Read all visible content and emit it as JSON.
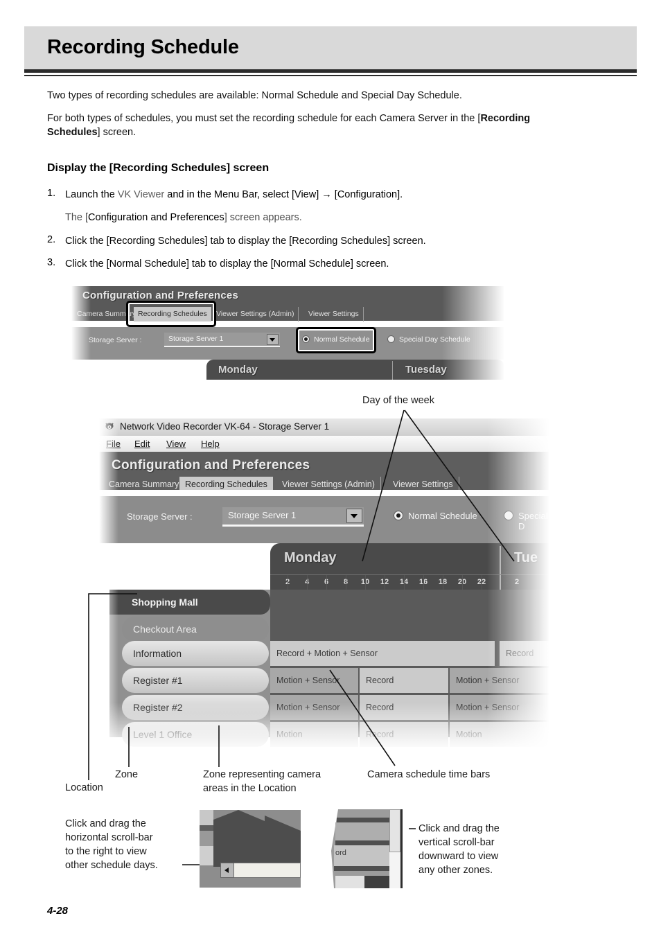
{
  "page": {
    "title": "Recording Schedule",
    "footer": "4-28"
  },
  "intro": {
    "para1": "Two types of recording schedules are available: Normal Schedule and Special Day Schedule.",
    "para2_a": "For both types of schedules, you must set the recording schedule for each Camera Server in the [",
    "para2_b": "Recording",
    "para2_c": "Schedules",
    "para2_d": "] screen."
  },
  "section": {
    "heading": "Display the [Recording Schedules] screen",
    "steps": [
      {
        "num": "1.",
        "text_a": "Launch the ",
        "text_b": "VK Viewer",
        "text_c": " and in the Menu Bar, select [View] → [Configuration]."
      },
      {
        "num": "",
        "text_a": "The [",
        "text_b": "Configuration and Preferences",
        "text_c": "] screen appears."
      },
      {
        "num": "2.",
        "text_a": "Click the [Recording Schedules] tab to display the [Recording Schedules] screen.",
        "text_b": "",
        "text_c": ""
      },
      {
        "num": "3.",
        "text_a": "Click the [Normal Schedule] tab to display the [Normal Schedule] screen.",
        "text_b": "",
        "text_c": ""
      }
    ]
  },
  "figure1": {
    "caption": "Configuration and Preferences",
    "tabs": [
      {
        "label": "Camera Summary",
        "active": false
      },
      {
        "label": "Recording Schedules",
        "active": true
      },
      {
        "label": "Viewer Settings (Admin)",
        "active": false
      },
      {
        "label": "Viewer Settings",
        "active": false
      }
    ],
    "storage_label": "Storage Server :",
    "storage_value": "Storage Server 1",
    "radios": [
      {
        "label": "Normal Schedule",
        "selected": true
      },
      {
        "label": "Special Day Schedule",
        "selected": false
      }
    ],
    "days": [
      "Monday",
      "Tuesday"
    ]
  },
  "figure2": {
    "window_title": "Network Video Recorder VK-64 - Storage Server 1",
    "menus": [
      "File",
      "Edit",
      "View",
      "Help"
    ],
    "caption": "Configuration and Preferences",
    "tabs": [
      {
        "label": "Camera Summary",
        "active": false
      },
      {
        "label": "Recording Schedules",
        "active": true
      },
      {
        "label": "Viewer Settings (Admin)",
        "active": false
      },
      {
        "label": "Viewer Settings",
        "active": false
      }
    ],
    "storage_label": "Storage Server :",
    "storage_value": "Storage Server 1",
    "radios": [
      {
        "label": "Normal Schedule",
        "selected": true
      },
      {
        "label": "Special D",
        "selected": false
      }
    ],
    "days": [
      "Monday",
      "Tue"
    ],
    "hours": [
      "2",
      "4",
      "6",
      "8",
      "10",
      "12",
      "14",
      "16",
      "18",
      "20",
      "22"
    ],
    "hours_next": [
      "2"
    ],
    "rows": [
      {
        "label": "Shopping Mall",
        "kind": "location",
        "cells": []
      },
      {
        "label": "Checkout Area",
        "kind": "zone",
        "cells": []
      },
      {
        "label": "Information",
        "kind": "camera",
        "cells": [
          {
            "text": "Record + Motion + Sensor",
            "span": "full",
            "tone": "light"
          },
          {
            "text": "Record",
            "span": "next",
            "tone": "light"
          }
        ]
      },
      {
        "label": "Register #1",
        "kind": "camera",
        "cells": [
          {
            "text": "Motion + Sensor",
            "span": "a",
            "tone": "dark"
          },
          {
            "text": "Record",
            "span": "b",
            "tone": "light"
          },
          {
            "text": "Motion + Sensor",
            "span": "c",
            "tone": "dark"
          }
        ]
      },
      {
        "label": "Register #2",
        "kind": "camera",
        "cells": [
          {
            "text": "Motion + Sensor",
            "span": "a",
            "tone": "dark"
          },
          {
            "text": "Record",
            "span": "b",
            "tone": "light"
          },
          {
            "text": "Motion + Sensor",
            "span": "c",
            "tone": "dark"
          }
        ]
      },
      {
        "label": "Level 1 Office",
        "kind": "camera",
        "cells": [
          {
            "text": "Motion",
            "span": "a",
            "tone": "light"
          },
          {
            "text": "Record",
            "span": "b",
            "tone": "light"
          },
          {
            "text": "Motion",
            "span": "c",
            "tone": "light"
          }
        ]
      }
    ]
  },
  "callouts": {
    "day_of_week": "Day of the week",
    "location": "Location",
    "zone": "Zone",
    "zone_cam_l1": "Zone representing camera",
    "zone_cam_l2": "areas in the Location",
    "time_bars": "Camera schedule time bars",
    "hscroll_l1": "Click and drag the",
    "hscroll_l2": "horizontal scroll-bar",
    "hscroll_l3": "to the right to view",
    "hscroll_l4": "other schedule days.",
    "vscroll_l1": "Click and drag the",
    "vscroll_l2": "vertical scroll-bar",
    "vscroll_l3": "downward to view",
    "vscroll_l4": "any other zones.",
    "detail_cell_text": "ord"
  },
  "colors": {
    "header_band": "#d9d9d9",
    "rule": "#2b2b2b",
    "ui_dark": "#4a4a4a",
    "ui_mid": "#8c8c8c",
    "cell_dark": "#a8a8a8",
    "cell_light": "#cbcbcb"
  }
}
